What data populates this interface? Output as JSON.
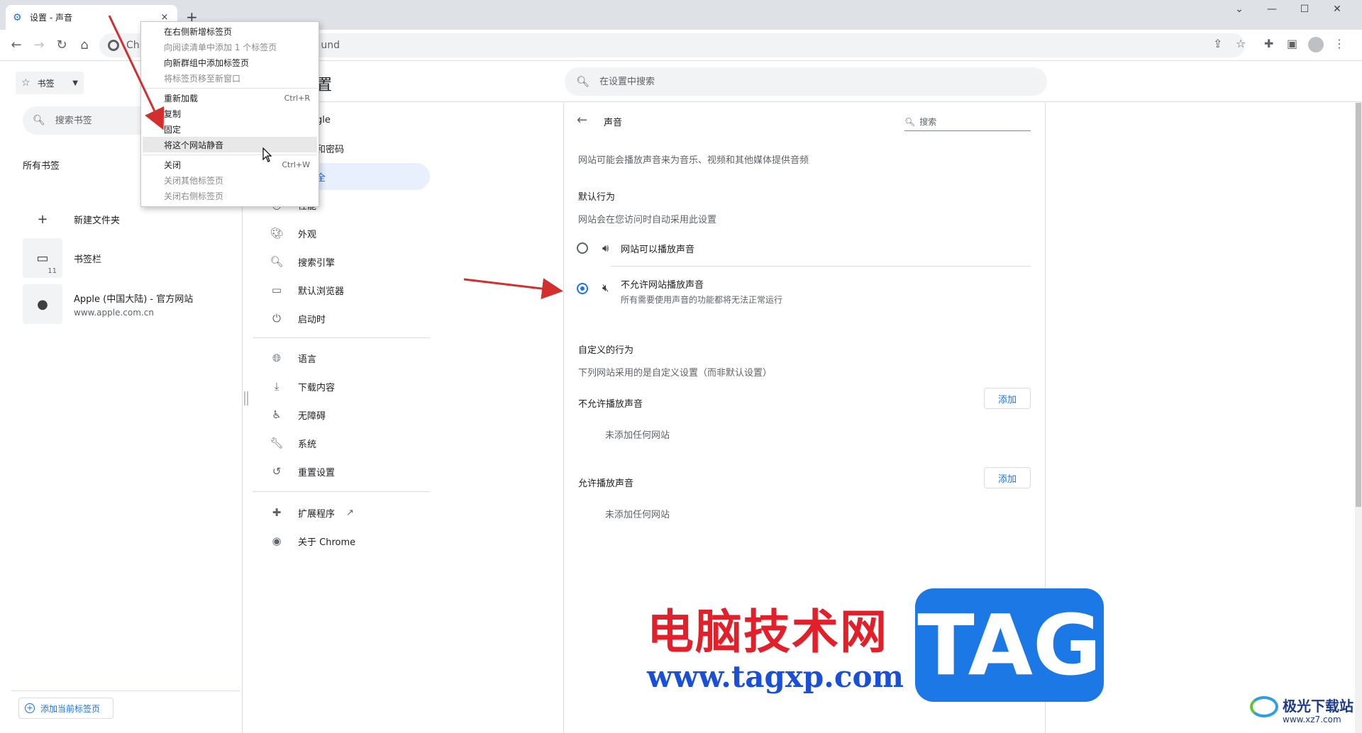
{
  "browser": {
    "tab_title": "设置 - 声音",
    "url_fragment_left": "Chr",
    "url_fragment_right": "und",
    "new_tab": "+",
    "close_glyph": "×",
    "win_minimize": "—",
    "win_maximize": "☐",
    "win_close": "✕",
    "win_tablist": "⌄"
  },
  "bookmarks_panel": {
    "dropdown_label": "书签",
    "search_placeholder": "搜索书签",
    "section_title": "所有书签",
    "items": [
      {
        "label": "新建文件夹"
      },
      {
        "label": "书签栏",
        "count": "11"
      },
      {
        "label": "Apple (中国大陆) - 官方网站",
        "url": "www.apple.com.cn"
      }
    ],
    "add_current_tab": "添加当前标签页"
  },
  "settings": {
    "title_fragment": "置",
    "search_placeholder": "在设置中搜索",
    "nav": [
      {
        "label": "Google",
        "icon": "person-icon"
      },
      {
        "label": "填充和密码",
        "icon": "autofill-icon"
      },
      {
        "label": "和安全",
        "icon": "shield-icon",
        "active": true
      },
      {
        "label": "性能",
        "icon": "speed-icon"
      },
      {
        "label": "外观",
        "icon": "palette-icon"
      },
      {
        "label": "搜索引擎",
        "icon": "search-icon"
      },
      {
        "label": "默认浏览器",
        "icon": "browser-icon"
      },
      {
        "label": "启动时",
        "icon": "power-icon"
      },
      {
        "label": "语言",
        "icon": "globe-icon"
      },
      {
        "label": "下载内容",
        "icon": "download-icon"
      },
      {
        "label": "无障碍",
        "icon": "accessibility-icon"
      },
      {
        "label": "系统",
        "icon": "wrench-icon"
      },
      {
        "label": "重置设置",
        "icon": "history-icon"
      },
      {
        "label": "扩展程序",
        "icon": "puzzle-icon"
      },
      {
        "label": "关于 Chrome",
        "icon": "chrome-icon"
      }
    ],
    "page": {
      "title": "声音",
      "search_placeholder": "搜索",
      "description": "网站可能会播放声音来为音乐、视频和其他媒体提供音频",
      "default_behavior_title": "默认行为",
      "default_behavior_desc": "网站会在您访问时自动采用此设置",
      "option_allow": "网站可以播放声音",
      "option_block": "不允许网站播放声音",
      "option_block_desc": "所有需要使用声音的功能都将无法正常运行",
      "selected_option": "block",
      "custom_title": "自定义的行为",
      "custom_desc": "下列网站采用的是自定义设置（而非默认设置）",
      "block_list_title": "不允许播放声音",
      "allow_list_title": "允许播放声音",
      "add_label": "添加",
      "empty_label": "未添加任何网站"
    }
  },
  "context_menu": {
    "items": [
      {
        "label": "在右侧新增标签页",
        "shortcut": "",
        "disabled": false
      },
      {
        "label": "向阅读清单中添加 1 个标签页",
        "shortcut": "",
        "disabled": true
      },
      {
        "label": "向新群组中添加标签页",
        "shortcut": "",
        "disabled": false
      },
      {
        "label": "将标签页移至新窗口",
        "shortcut": "",
        "disabled": true
      },
      {
        "label": "重新加载",
        "shortcut": "Ctrl+R",
        "disabled": false
      },
      {
        "label": "复制",
        "shortcut": "",
        "disabled": false
      },
      {
        "label": "固定",
        "shortcut": "",
        "disabled": false
      },
      {
        "label": "将这个网站静音",
        "shortcut": "",
        "disabled": false,
        "highlighted": true
      },
      {
        "label": "关闭",
        "shortcut": "Ctrl+W",
        "disabled": false
      },
      {
        "label": "关闭其他标签页",
        "shortcut": "",
        "disabled": true
      },
      {
        "label": "关闭右侧标签页",
        "shortcut": "",
        "disabled": true
      }
    ]
  },
  "watermark": {
    "site_name": "电脑技术网",
    "site_url": "www.tagxp.com",
    "tag": "TAG",
    "brand2_name": "极光下载站",
    "brand2_url": "www.xz7.com"
  },
  "colors": {
    "accent": "#1a73e8",
    "annotation_arrow": "#d32f2f",
    "watermark_red": "#e3202a",
    "watermark_blue": "#1b78e5"
  }
}
